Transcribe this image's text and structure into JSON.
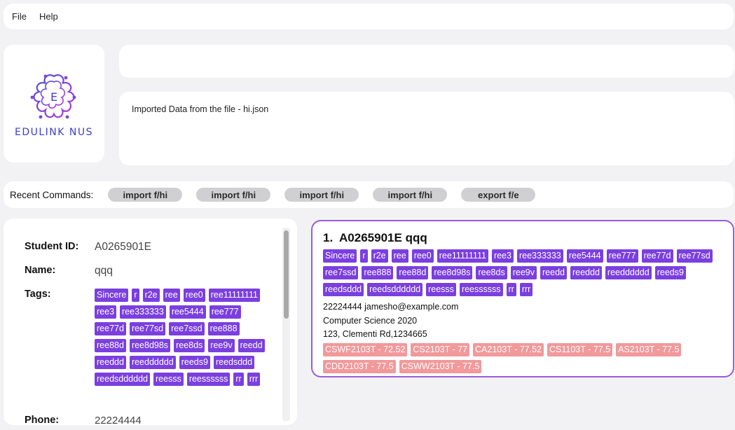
{
  "menu": {
    "items": [
      "File",
      "Help"
    ]
  },
  "logo": {
    "text": "EDULINK NUS",
    "accent": "#3a3fc9",
    "letter": "E"
  },
  "command_box": {
    "value": "",
    "placeholder": ""
  },
  "result_box": {
    "message": "Imported Data from the file - hi.json"
  },
  "recent_commands": {
    "label": "Recent Commands:",
    "items": [
      "import f/hi",
      "import f/hi",
      "import f/hi",
      "import f/hi",
      "export f/e"
    ]
  },
  "detail": {
    "id_label": "Student ID:",
    "id_value": "A0265901E",
    "name_label": "Name:",
    "name_value": "qqq",
    "tags_label": "Tags:",
    "tags": [
      "Sincere",
      "r",
      "r2e",
      "ree",
      "ree0",
      "ree11111111",
      "ree3",
      "ree333333",
      "ree5444",
      "ree777",
      "ree77d",
      "ree77sd",
      "ree7ssd",
      "ree888",
      "ree88d",
      "ree8d98s",
      "ree8ds",
      "ree9v",
      "reedd",
      "reeddd",
      "reedddddd",
      "reeds9",
      "reedsddd",
      "reedsdddddd",
      "reesss",
      "reessssss",
      "rr",
      "rrr"
    ],
    "cutoff_label": "Phone:",
    "cutoff_value": "22224444"
  },
  "card": {
    "index": "1.",
    "id": "A0265901E",
    "name": "qqq",
    "tags": [
      "Sincere",
      "r",
      "r2e",
      "ree",
      "ree0",
      "ree11111111",
      "ree3",
      "ree333333",
      "ree5444",
      "ree777",
      "ree77d",
      "ree77sd",
      "ree7ssd",
      "ree888",
      "ree88d",
      "ree8d98s",
      "ree8ds",
      "ree9v",
      "reedd",
      "reeddd",
      "reedddddd",
      "reeds9",
      "reedsddd",
      "reedsdddddd",
      "reesss",
      "reessssss",
      "rr",
      "rrr"
    ],
    "contact": "22224444  jamesho@example.com",
    "major_year": "Computer Science  2020",
    "address": "123, Clementi Rd,1234665",
    "grades": [
      "CSWF2103T - 72.52",
      "CS2103T - 77",
      "CA2103T - 77.52",
      "CS1103T - 77.5",
      "AS2103T - 77.5",
      "CDD2103T - 77.5",
      "CSWW2103T - 77.5"
    ]
  },
  "colors": {
    "tag": "#7b3fe0",
    "grade": "#f1999b",
    "card_border": "#9a5ae0",
    "background": "#f2f2f4"
  }
}
